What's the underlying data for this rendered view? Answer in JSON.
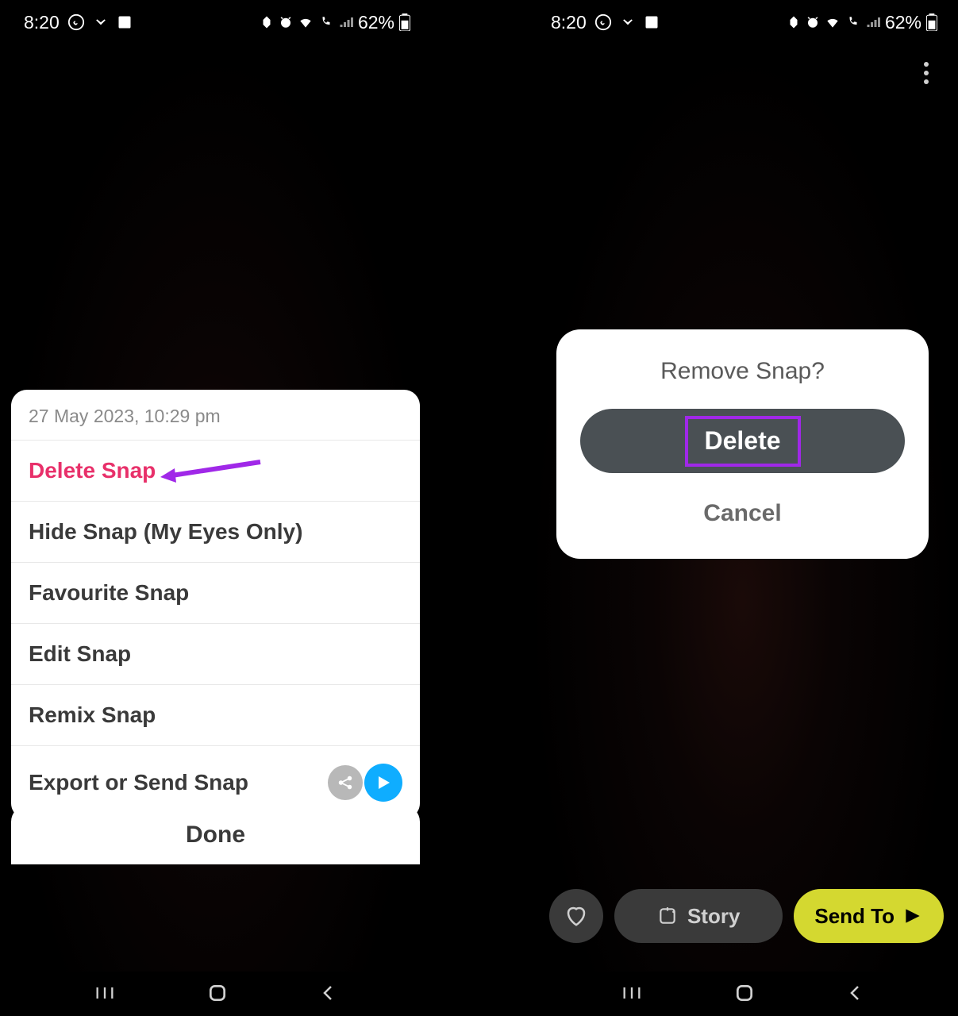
{
  "status": {
    "time": "8:20",
    "battery": "62%"
  },
  "left": {
    "menu_timestamp": "27 May 2023, 10:29 pm",
    "items": {
      "delete": "Delete Snap",
      "hide": "Hide Snap (My Eyes Only)",
      "favourite": "Favourite Snap",
      "edit": "Edit Snap",
      "remix": "Remix Snap",
      "export": "Export or Send Snap"
    },
    "done": "Done"
  },
  "right": {
    "dialog": {
      "title": "Remove Snap?",
      "delete": "Delete",
      "cancel": "Cancel"
    },
    "actions": {
      "story": "Story",
      "sendto": "Send To"
    }
  },
  "colors": {
    "danger": "#e8306a",
    "accent_yellow": "#d4d830",
    "accent_blue": "#0fadff",
    "highlight": "#a028e8"
  }
}
